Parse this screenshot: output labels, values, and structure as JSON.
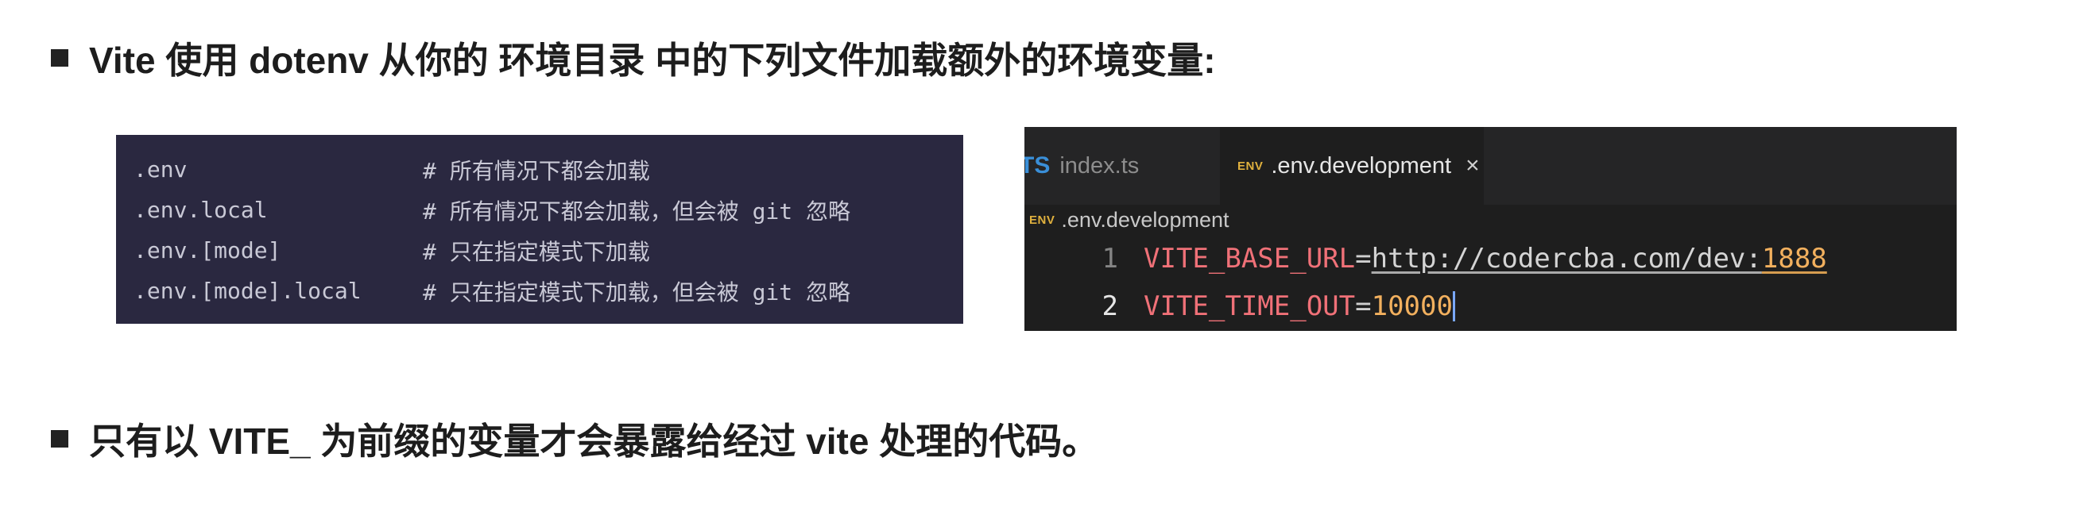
{
  "headings": {
    "first": "Vite 使用 dotenv 从你的 环境目录 中的下列文件加载额外的环境变量:",
    "second": "只有以 VITE_ 为前缀的变量才会暴露给经过 vite 处理的代码。"
  },
  "env_files_table": [
    {
      "file": ".env",
      "comment": "# 所有情况下都会加载"
    },
    {
      "file": ".env.local",
      "comment": "# 所有情况下都会加载，但会被 git 忽略"
    },
    {
      "file": ".env.[mode]",
      "comment": "# 只在指定模式下加载"
    },
    {
      "file": ".env.[mode].local",
      "comment": "# 只在指定模式下加载，但会被 git 忽略"
    }
  ],
  "editor": {
    "tabs": [
      {
        "icon_text": "TS",
        "label": "index.ts",
        "active": false
      },
      {
        "icon_text": "ENV",
        "label": ".env.development",
        "active": true,
        "close": "×"
      }
    ],
    "breadcrumb": {
      "icon_text": "ENV",
      "label": ".env.development"
    },
    "lines": [
      {
        "number": "1",
        "key": "VITE_BASE_URL",
        "eq": "=",
        "url": "http://codercba.com/dev:",
        "port": "1888"
      },
      {
        "number": "2",
        "key": "VITE_TIME_OUT",
        "eq": "=",
        "value": "10000"
      }
    ]
  },
  "colors": {
    "code_bg": "#2a2840",
    "editor_bg": "#1e1e1e",
    "tabbar_bg": "#252526",
    "key": "#f07178",
    "number": "#f2b05e",
    "ts_icon": "#3a8fd8",
    "env_icon": "#e0b13e"
  },
  "icons": {
    "bullet": "black-square-bullet-icon",
    "ts": "typescript-file-icon",
    "env": "env-file-icon",
    "close": "close-icon"
  }
}
